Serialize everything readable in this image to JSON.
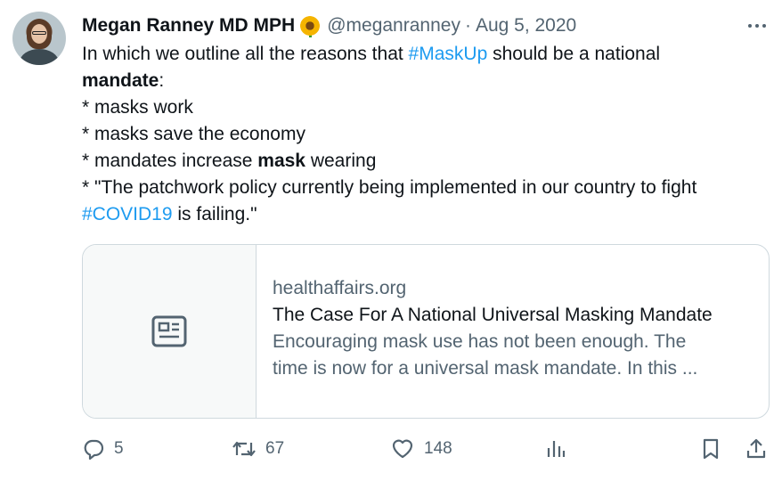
{
  "author": {
    "name": "Megan Ranney MD MPH",
    "emoji": "sunflower-emoji",
    "handle": "@meganranney",
    "separator": "·",
    "date": "Aug 5, 2020"
  },
  "tweet": {
    "line1_a": "In which we outline all the reasons that ",
    "line1_hashtag": "#MaskUp",
    "line1_b": " should be a national",
    "line2_bold": "mandate",
    "line2_b": ":",
    "line3": "* masks work",
    "line4": "* masks save the economy",
    "line5_a": "* mandates increase ",
    "line5_bold": "mask",
    "line5_b": " wearing",
    "line6": "* \"The patchwork policy currently being implemented in our country to fight",
    "line7_hashtag": "#COVID19",
    "line7_b": " is failing.\""
  },
  "card": {
    "icon": "article-icon",
    "domain": "healthaffairs.org",
    "title": "The Case For A National Universal Masking Mandate",
    "description_line1": "Encouraging mask use has not been enough. The",
    "description_line2": "time is now for a universal mask mandate. In this ..."
  },
  "actions": {
    "replies": "5",
    "retweets": "67",
    "likes": "148"
  },
  "colors": {
    "link": "#1d9bf0",
    "muted": "#536471",
    "text": "#0f1419",
    "border": "#cfd9de"
  }
}
